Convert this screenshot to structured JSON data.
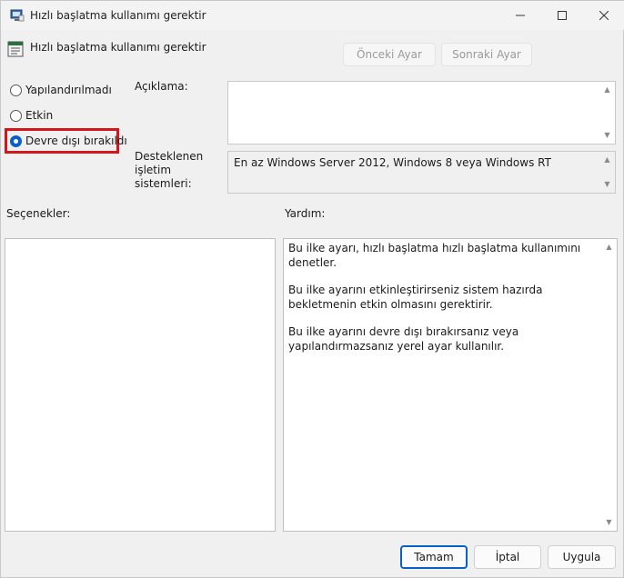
{
  "window": {
    "title": "Hızlı başlatma kullanımı gerektir"
  },
  "header": {
    "title": "Hızlı başlatma kullanımı gerektir",
    "prev_label": "Önceki Ayar",
    "next_label": "Sonraki Ayar"
  },
  "radios": {
    "not_configured": "Yapılandırılmadı",
    "enabled": "Etkin",
    "disabled": "Devre dışı bırakıldı",
    "selected": "disabled"
  },
  "labels": {
    "description": "Açıklama:",
    "supported": "Desteklenen işletim sistemleri:",
    "options": "Seçenekler:",
    "help": "Yardım:"
  },
  "supported_value": "En az Windows Server 2012, Windows 8 veya Windows RT",
  "help": {
    "p1": "Bu ilke ayarı, hızlı başlatma hızlı başlatma kullanımını denetler.",
    "p2": "Bu ilke ayarını etkinleştirirseniz sistem hazırda bekletmenin etkin olmasını gerektirir.",
    "p3": "Bu ilke ayarını devre dışı bırakırsanız veya yapılandırmazsanız yerel ayar kullanılır."
  },
  "footer": {
    "ok": "Tamam",
    "cancel": "İptal",
    "apply": "Uygula"
  },
  "colors": {
    "accent": "#0a5fc8",
    "highlight": "#d3161b"
  }
}
